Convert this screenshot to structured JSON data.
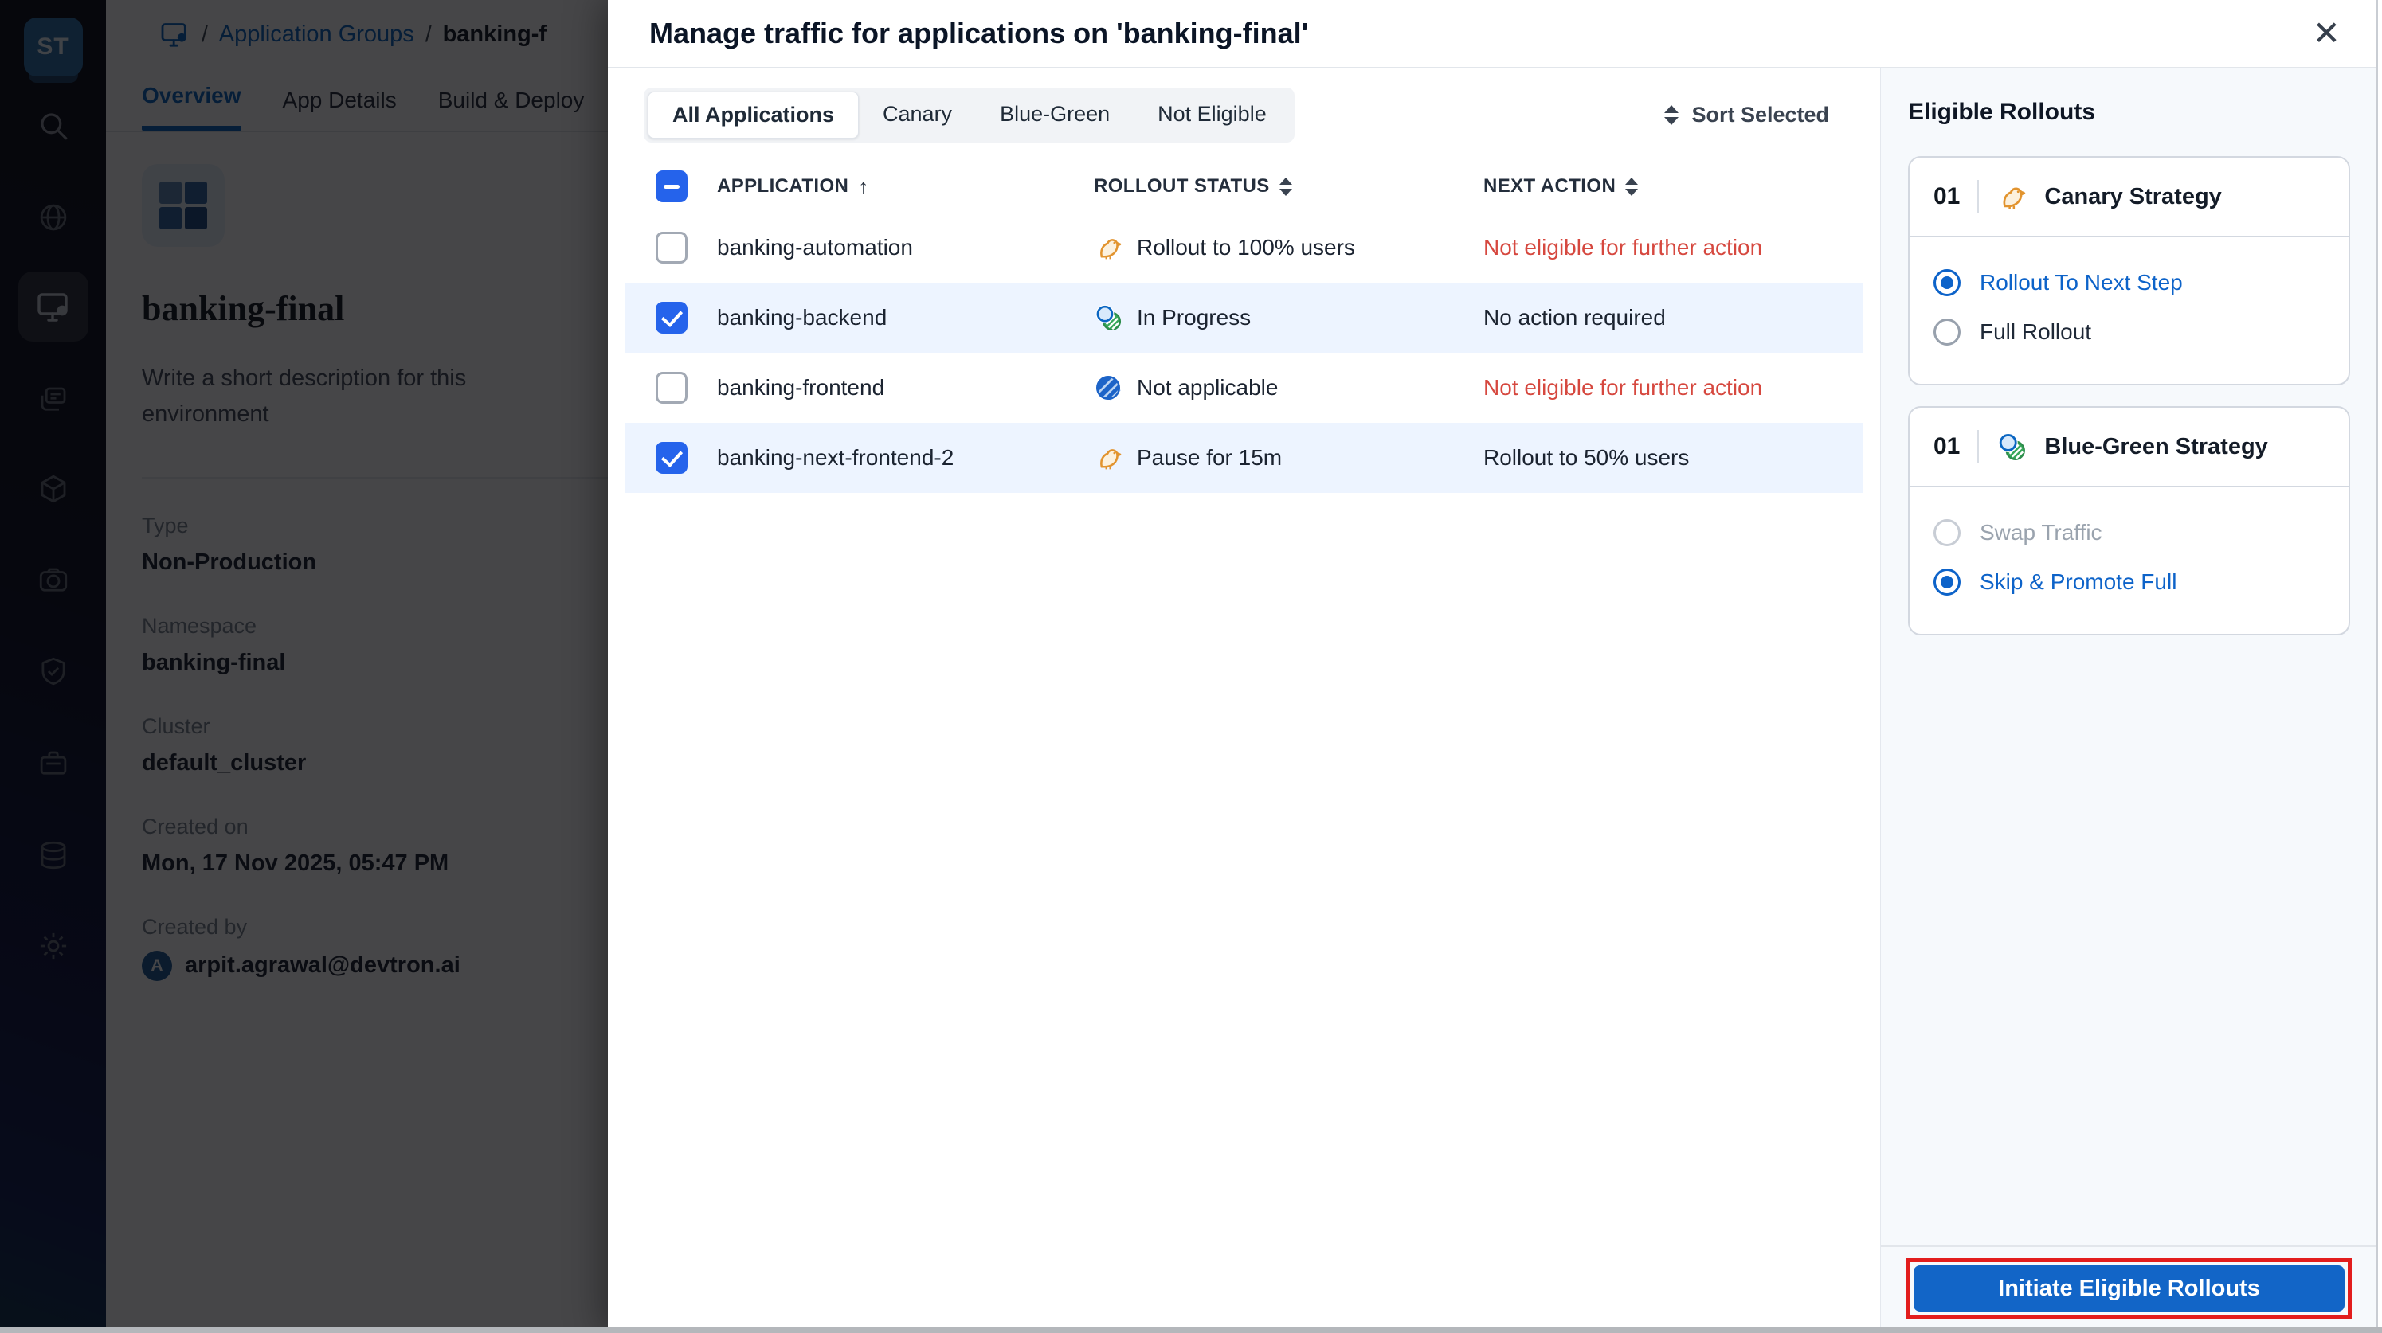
{
  "colors": {
    "accent_blue": "#0B66C2",
    "button_blue": "#1265C7",
    "checkbox_blue": "#2563EB",
    "error_red": "#D6483F",
    "row_highlight": "#EDF4FF",
    "panel_bg": "#F6F9FC",
    "annotation_red": "#E21D1D",
    "canary_orange": "#E2942F",
    "green": "#39A85B"
  },
  "sidebar": {
    "logo_text": "ST",
    "items": [
      {
        "icon": "search-icon"
      },
      {
        "icon": "globe-icon"
      },
      {
        "icon": "application-groups-icon",
        "active": true
      },
      {
        "icon": "stack-icon"
      },
      {
        "icon": "package-icon"
      },
      {
        "icon": "camera-icon"
      },
      {
        "icon": "shield-check-icon"
      },
      {
        "icon": "briefcase-icon"
      },
      {
        "icon": "database-icon"
      },
      {
        "icon": "gear-icon"
      }
    ]
  },
  "page": {
    "breadcrumb": {
      "sep1": "/",
      "link": "Application Groups",
      "sep2": "/",
      "current": "banking-f"
    },
    "tabs": [
      {
        "label": "Overview",
        "active": true
      },
      {
        "label": "App Details"
      },
      {
        "label": "Build & Deploy"
      }
    ],
    "env": {
      "name": "banking-final",
      "description_placeholder": "Write a short description for this environment",
      "fields": [
        {
          "label": "Type",
          "value": "Non-Production"
        },
        {
          "label": "Namespace",
          "value": "banking-final"
        },
        {
          "label": "Cluster",
          "value": "default_cluster"
        },
        {
          "label": "Created on",
          "value": "Mon, 17 Nov 2025, 05:47 PM"
        }
      ],
      "created_by_label": "Created by",
      "created_by_avatar": "A",
      "created_by": "arpit.agrawal@devtron.ai"
    }
  },
  "modal": {
    "title": "Manage traffic for applications on 'banking-final'",
    "close_icon": "✕",
    "filter_tabs": [
      {
        "label": "All Applications",
        "active": true
      },
      {
        "label": "Canary"
      },
      {
        "label": "Blue-Green"
      },
      {
        "label": "Not Eligible"
      }
    ],
    "sort_button": "Sort Selected",
    "table": {
      "select_all_state": "indeterminate",
      "columns": [
        {
          "label": "APPLICATION",
          "sort_icon": "↑"
        },
        {
          "label": "ROLLOUT STATUS"
        },
        {
          "label": "NEXT ACTION"
        }
      ],
      "rows": [
        {
          "name": "banking-automation",
          "checked": false,
          "status": "Rollout to 100% users",
          "status_icon": "canary-icon",
          "action": "Not eligible for further action",
          "eligible": false
        },
        {
          "name": "banking-backend",
          "checked": true,
          "status": "In Progress",
          "status_icon": "blue-green-icon",
          "action": "No action required",
          "eligible": true
        },
        {
          "name": "banking-frontend",
          "checked": false,
          "status": "Not applicable",
          "status_icon": "not-applicable-icon",
          "action": "Not eligible for further action",
          "eligible": false
        },
        {
          "name": "banking-next-frontend-2",
          "checked": true,
          "status": "Pause for 15m",
          "status_icon": "canary-icon",
          "action": "Rollout to 50% users",
          "eligible": true
        }
      ]
    },
    "eligible_rollouts": {
      "heading": "Eligible Rollouts",
      "strategies": [
        {
          "index": "01",
          "icon": "canary-icon",
          "name": "Canary Strategy",
          "options": [
            {
              "label": "Rollout To Next Step",
              "selected": true,
              "disabled": false
            },
            {
              "label": "Full Rollout",
              "selected": false,
              "disabled": false
            }
          ]
        },
        {
          "index": "01",
          "icon": "blue-green-icon",
          "name": "Blue-Green Strategy",
          "options": [
            {
              "label": "Swap Traffic",
              "selected": false,
              "disabled": true
            },
            {
              "label": "Skip & Promote Full",
              "selected": true,
              "disabled": false
            }
          ]
        }
      ],
      "cta": "Initiate Eligible Rollouts"
    }
  }
}
